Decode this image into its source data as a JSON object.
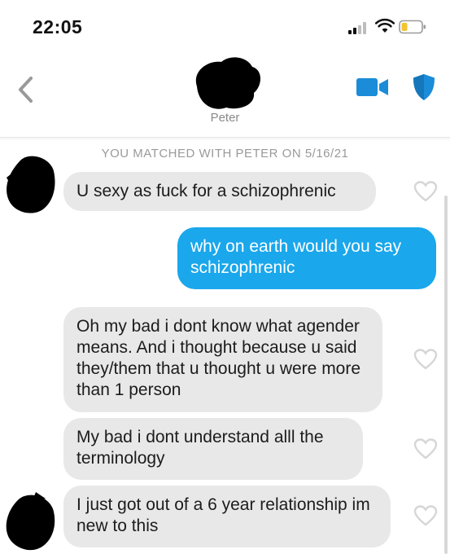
{
  "status_bar": {
    "time": "22:05"
  },
  "header": {
    "match_name": "Peter",
    "icons": [
      "back-chevron-icon",
      "video-call-icon",
      "shield-icon"
    ],
    "accent_color": "#1a8cd8"
  },
  "chat": {
    "matched_banner": "YOU MATCHED WITH PETER ON 5/16/21",
    "messages": [
      {
        "sender": "match",
        "text": "U sexy as fuck for a schizophrenic"
      },
      {
        "sender": "me",
        "text": "why on earth would you say schizophrenic"
      },
      {
        "sender": "match",
        "text": "Oh my bad i dont know what agender means. And i thought because u said they/them that u thought u were more than 1 person"
      },
      {
        "sender": "match",
        "text": "My bad i dont understand alll the terminology"
      },
      {
        "sender": "match",
        "text": "I just got out of a 6 year relationship im new to this"
      }
    ],
    "colors": {
      "incoming_bubble": "#e8e8e8",
      "outgoing_bubble": "#1aa7ec"
    }
  }
}
